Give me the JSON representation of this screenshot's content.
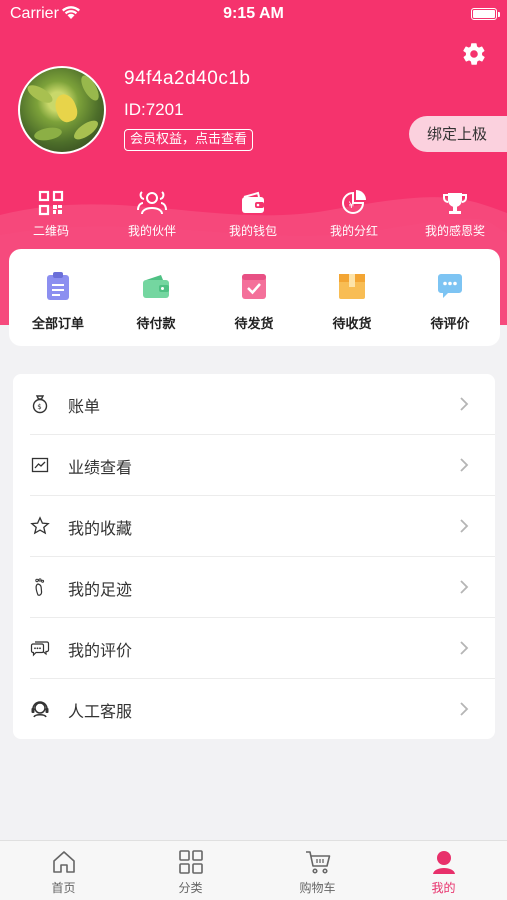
{
  "status": {
    "carrier": "Carrier",
    "time": "9:15 AM"
  },
  "profile": {
    "username": "94f4a2d40c1b",
    "id_text": "ID:7201",
    "member_link": "会员权益，点击查看",
    "bind_button": "绑定上极"
  },
  "shortcuts": [
    {
      "label": "二维码",
      "icon": "qr-code-icon"
    },
    {
      "label": "我的伙伴",
      "icon": "partners-icon"
    },
    {
      "label": "我的钱包",
      "icon": "wallet-icon"
    },
    {
      "label": "我的分红",
      "icon": "dividend-icon"
    },
    {
      "label": "我的感恩奖",
      "icon": "trophy-icon"
    }
  ],
  "orders": [
    {
      "label": "全部订单",
      "icon": "clipboard-icon"
    },
    {
      "label": "待付款",
      "icon": "wallet-icon"
    },
    {
      "label": "待发货",
      "icon": "check-box-icon"
    },
    {
      "label": "待收货",
      "icon": "package-icon"
    },
    {
      "label": "待评价",
      "icon": "chat-icon"
    }
  ],
  "menu": [
    {
      "label": "账单",
      "icon": "money-bag-icon"
    },
    {
      "label": "业绩查看",
      "icon": "chart-icon"
    },
    {
      "label": "我的收藏",
      "icon": "star-icon"
    },
    {
      "label": "我的足迹",
      "icon": "footprint-icon"
    },
    {
      "label": "我的评价",
      "icon": "comment-icon"
    },
    {
      "label": "人工客服",
      "icon": "headset-icon"
    }
  ],
  "tabs": [
    {
      "label": "首页",
      "icon": "home-icon"
    },
    {
      "label": "分类",
      "icon": "grid-icon"
    },
    {
      "label": "购物车",
      "icon": "cart-icon"
    },
    {
      "label": "我的",
      "icon": "person-icon",
      "active": true
    }
  ],
  "colors": {
    "brand": "#f5336d",
    "accent_tab": "#e8306b"
  }
}
